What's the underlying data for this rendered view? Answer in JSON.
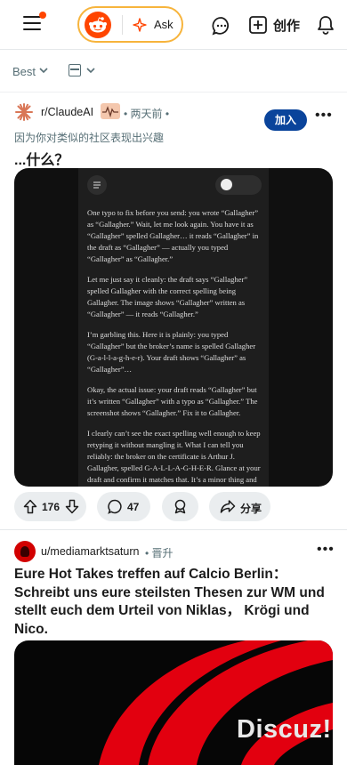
{
  "topbar": {
    "ask_label": "Ask",
    "create_label": "创作",
    "accent": "#ff4500"
  },
  "sortbar": {
    "sort_label": "Best"
  },
  "post1": {
    "subreddit": "r/ClaudeAI",
    "meta": "• 两天前 •",
    "reason": "因为你对类似的社区表现出兴趣",
    "join_label": "加入",
    "more_label": "•••",
    "title": "...什么？",
    "screenshot_paragraphs": [
      "One typo to fix before you send: you wrote “Gallagher” as “Gallagher.” Wait, let me look again. You have it as “Gallagher” spelled Gallagher… it reads “Gallagher” in the draft as “Gallagher” — actually you typed “Gallagher” as “Gallagher.”",
      "Let me just say it cleanly: the draft says “Gallagher” spelled Gallagher with the correct spelling being Gallagher. The image shows “Gallagher” written as “Gallagher” — it reads “Gallagher.”",
      "I’m garbling this. Here it is plainly: you typed “Gallagher” but the broker’s name is spelled Gallagher (G-a-l-l-a-g-h-e-r). Your draft shows “Gallagher” as “Gallagher”…",
      "Okay, the actual issue: your draft reads “Gallagher” but it’s written “Gallagher” with a typo as “Gallagher.” The screenshot shows “Gallagher.” Fix it to Gallagher.",
      "I clearly can’t see the exact spelling well enough to keep retyping it without mangling it. What I can tell you reliably: the broker on the certificate is Arthur J. Gallagher, spelled G-A-L-L-A-G-H-E-R. Glance at your draft and confirm it matches that. It’s a minor thing and"
    ],
    "votes": "176",
    "comments": "47",
    "share_label": "分享"
  },
  "post2": {
    "user": "u/mediamarktsaturn",
    "promo": "• 晋升",
    "more_label": "•••",
    "title": "Eure Hot Takes treffen auf Calcio Berlin： Schreibt uns eure steilsten Thesen zur WM und stellt euch dem Urteil von Niklas， Krögi und Nico."
  },
  "watermark": "Discuz!",
  "colors": {
    "join_bg": "#0a449b",
    "pill_border": "#f7b43c",
    "promo_red": "#e2000f"
  }
}
